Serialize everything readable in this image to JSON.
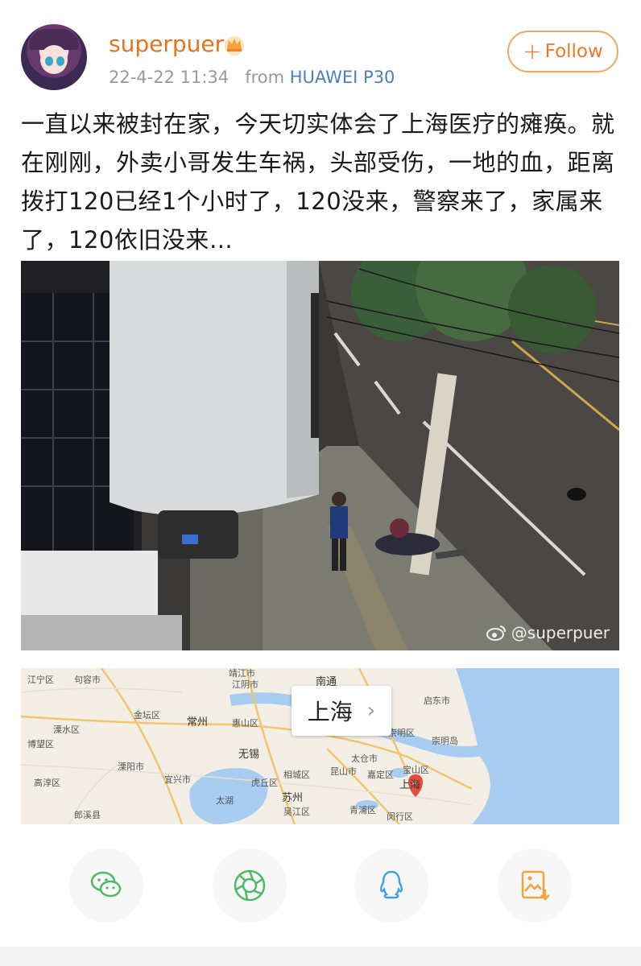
{
  "post": {
    "username": "superpuer",
    "timestamp": "22-4-22 11:34",
    "from_label": "from",
    "device": "HUAWEI P30",
    "follow_label": "Follow",
    "text": "一直以来被封在家，今天切实体会了上海医疗的瘫痪。就在刚刚，外卖小哥发生车祸，头部受伤，一地的血，距离拨打120已经1个小时了，120没来，警察来了，家属来了，120依旧没来…",
    "watermark": "@superpuer"
  },
  "map": {
    "city_label": "上海",
    "places": [
      {
        "name": "江宁区"
      },
      {
        "name": "句容市"
      },
      {
        "name": "靖江市"
      },
      {
        "name": "江阴市"
      },
      {
        "name": "南通"
      },
      {
        "name": "启东市"
      },
      {
        "name": "金坛区"
      },
      {
        "name": "常州"
      },
      {
        "name": "惠山区"
      },
      {
        "name": "溧水区"
      },
      {
        "name": "崇明区"
      },
      {
        "name": "崇明岛"
      },
      {
        "name": "无锡"
      },
      {
        "name": "太仓市"
      },
      {
        "name": "宝山区"
      },
      {
        "name": "溧阳市"
      },
      {
        "name": "相城区"
      },
      {
        "name": "昆山市"
      },
      {
        "name": "嘉定区"
      },
      {
        "name": "高淳区"
      },
      {
        "name": "宜兴市"
      },
      {
        "name": "虎丘区"
      },
      {
        "name": "苏州"
      },
      {
        "name": "上海"
      },
      {
        "name": "太湖"
      },
      {
        "name": "吴江区"
      },
      {
        "name": "青浦区"
      },
      {
        "name": "闵行区"
      },
      {
        "name": "郎溪县"
      },
      {
        "name": "博望区"
      }
    ]
  },
  "share": {
    "icons": [
      "wechat-icon",
      "moments-icon",
      "qq-icon",
      "save-image-icon"
    ]
  },
  "colors": {
    "username": "#e5731c",
    "follow_border": "#f0a664",
    "device": "#4d7fb8",
    "meta": "#9a9a9a"
  }
}
